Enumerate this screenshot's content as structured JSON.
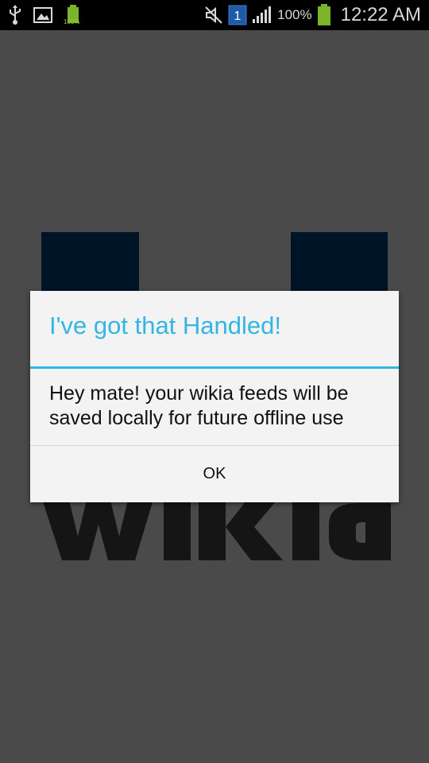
{
  "status_bar": {
    "small_battery_label": "100%",
    "sim_label": "1",
    "battery_percent": "100%",
    "clock": "12:22 AM",
    "icons": [
      "usb-icon",
      "image-icon",
      "battery-small-icon",
      "mute-icon",
      "sim-icon",
      "signal-icon",
      "battery-icon"
    ]
  },
  "dialog": {
    "title": "I've got that Handled!",
    "message": "Hey mate! your wikia feeds will be saved locally for future offline use",
    "ok_label": "OK"
  },
  "colors": {
    "accent": "#33b5e5",
    "dialog_bg": "#f3f3f3",
    "overlay": "#4a4a4a",
    "battery_green": "#9ecb3a"
  }
}
